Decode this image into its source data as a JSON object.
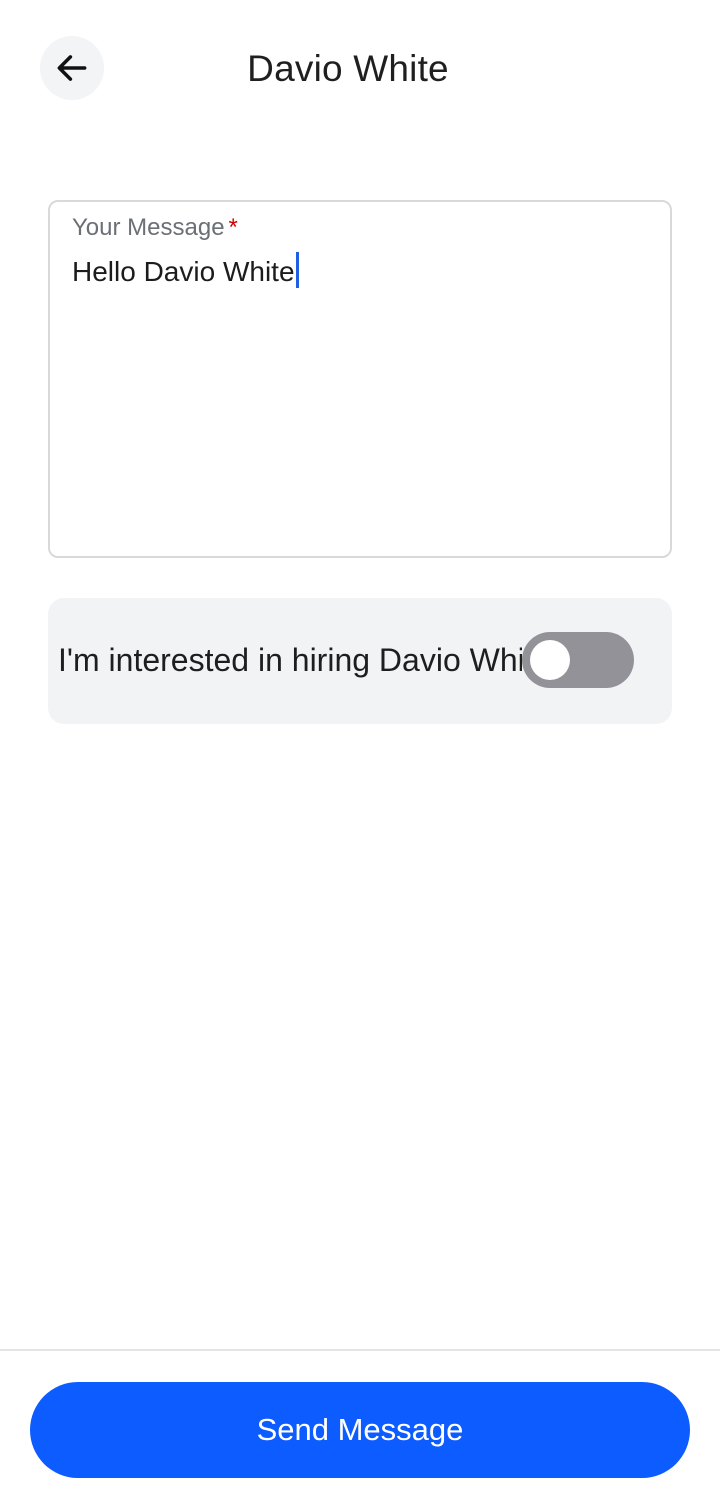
{
  "header": {
    "title": "Davio White",
    "back_icon": "arrow-left-icon"
  },
  "message": {
    "label": "Your Message",
    "required_mark": "*",
    "value": "Hello Davio White",
    "required_color": "#d40000"
  },
  "hiring_toggle": {
    "label": "I'm interested in hiring Davio White",
    "enabled": false
  },
  "footer": {
    "send_label": "Send Message",
    "accent_color": "#0d5cff"
  }
}
